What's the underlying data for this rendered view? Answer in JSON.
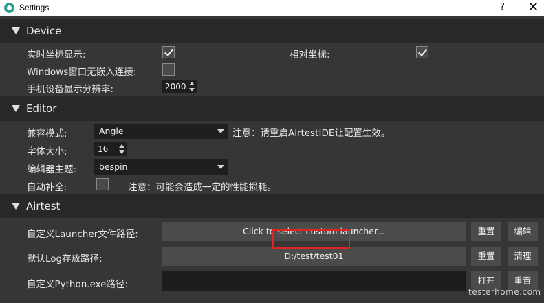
{
  "window": {
    "title": "Settings",
    "help": "?",
    "close": "✕"
  },
  "device": {
    "header": "Device",
    "realtime_coords_label": "实时坐标显示:",
    "realtime_coords_checked": true,
    "relative_coords_label": "相对坐标:",
    "relative_coords_checked": true,
    "windows_embed_label": "Windows窗口无嵌入连接:",
    "windows_embed_checked": false,
    "resolution_label": "手机设备显示分辨率:",
    "resolution_value": "2000"
  },
  "editor": {
    "header": "Editor",
    "compat_label": "兼容模式:",
    "compat_value": "Angle",
    "compat_note": "注意：请重启AirtestIDE让配置生效。",
    "font_size_label": "字体大小:",
    "font_size_value": "16",
    "theme_label": "编辑器主题:",
    "theme_value": "bespin",
    "autocomplete_label": "自动补全:",
    "autocomplete_checked": false,
    "autocomplete_note": "注意：可能会造成一定的性能损耗。"
  },
  "airtest": {
    "header": "Airtest",
    "launcher_label": "自定义Launcher文件路径:",
    "launcher_value": "Click to select custom launcher...",
    "launcher_reset": "重置",
    "launcher_edit": "编辑",
    "log_label": "默认Log存放路径:",
    "log_value": "D:/test/test01",
    "log_reset": "重置",
    "log_clear": "清理",
    "python_label": "自定义Python.exe路径:",
    "python_value": "",
    "python_open": "打开",
    "python_reset": "重置"
  },
  "watermark": "testerhome.com"
}
